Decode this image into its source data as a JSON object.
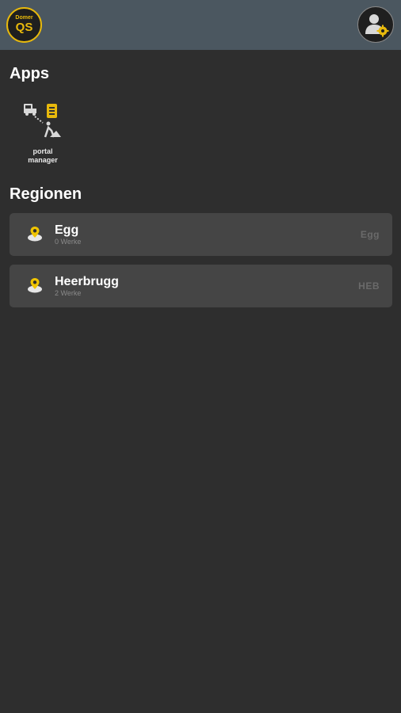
{
  "header": {
    "logo": {
      "top_text": "Domer",
      "main_text": "QS"
    },
    "profile_icon": "user-settings-icon"
  },
  "apps": {
    "title": "Apps",
    "items": [
      {
        "label_line1": "portal",
        "label_line2": "manager",
        "icon": "portal-manager-icon"
      }
    ]
  },
  "regions": {
    "title": "Regionen",
    "items": [
      {
        "name": "Egg",
        "subtitle": "0 Werke",
        "code": "Egg",
        "icon": "location-pin-icon"
      },
      {
        "name": "Heerbrugg",
        "subtitle": "2 Werke",
        "code": "HEB",
        "icon": "location-pin-icon"
      }
    ]
  },
  "colors": {
    "background": "#2e2e2e",
    "topbar": "#4b5760",
    "card": "#454545",
    "accent": "#e8b90c"
  }
}
